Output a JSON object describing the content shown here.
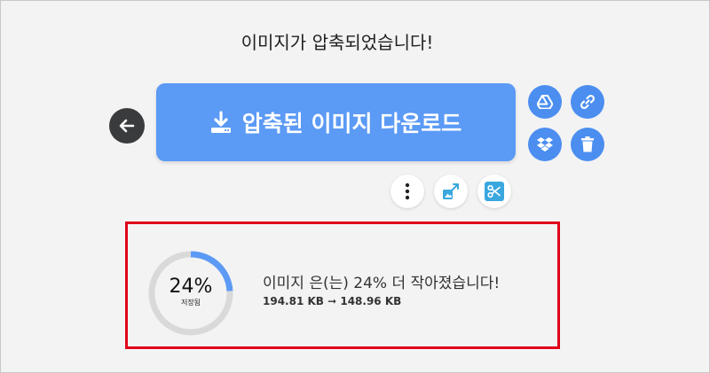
{
  "header": {
    "title": "이미지가 압축되었습니다!"
  },
  "actions": {
    "download_label": "압축된 이미지 다운로드",
    "back_icon": "arrow-left-icon",
    "side_icons": [
      "google-drive-icon",
      "link-icon",
      "dropbox-icon",
      "trash-icon"
    ],
    "tool_icons": [
      "more-vertical-icon",
      "resize-icon",
      "crop-icon"
    ]
  },
  "result": {
    "percent_text": "24%",
    "saved_label": "저장됨",
    "saved_fraction": 0.24,
    "message": "이미지 은(는) 24% 더 작아졌습니다!",
    "size_text": "194.81 KB ➞ 148.96 KB"
  },
  "colors": {
    "primary": "#5b9af5",
    "icon_button": "#4b8ef0",
    "highlight_border": "#e0001a",
    "ring_track": "#d9d9d9",
    "ring_fill": "#5b9af5"
  }
}
